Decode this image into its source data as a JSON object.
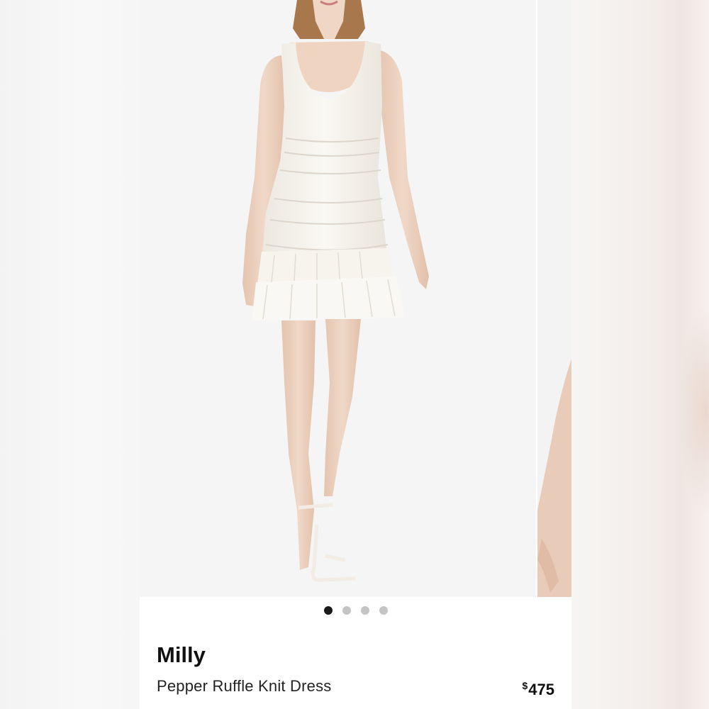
{
  "product": {
    "brand": "Milly",
    "name": "Pepper Ruffle Knit Dress",
    "price_currency": "$",
    "price_amount": "475"
  },
  "carousel": {
    "image_count": 4,
    "active_index": 0,
    "dot_colors": {
      "active": "#1a1a1a",
      "inactive": "#c4c4c4"
    }
  },
  "colors": {
    "dress": "#f7f4ee",
    "skin": "#edd3c1",
    "hair": "#a8784c",
    "background": "#f5f5f5"
  }
}
